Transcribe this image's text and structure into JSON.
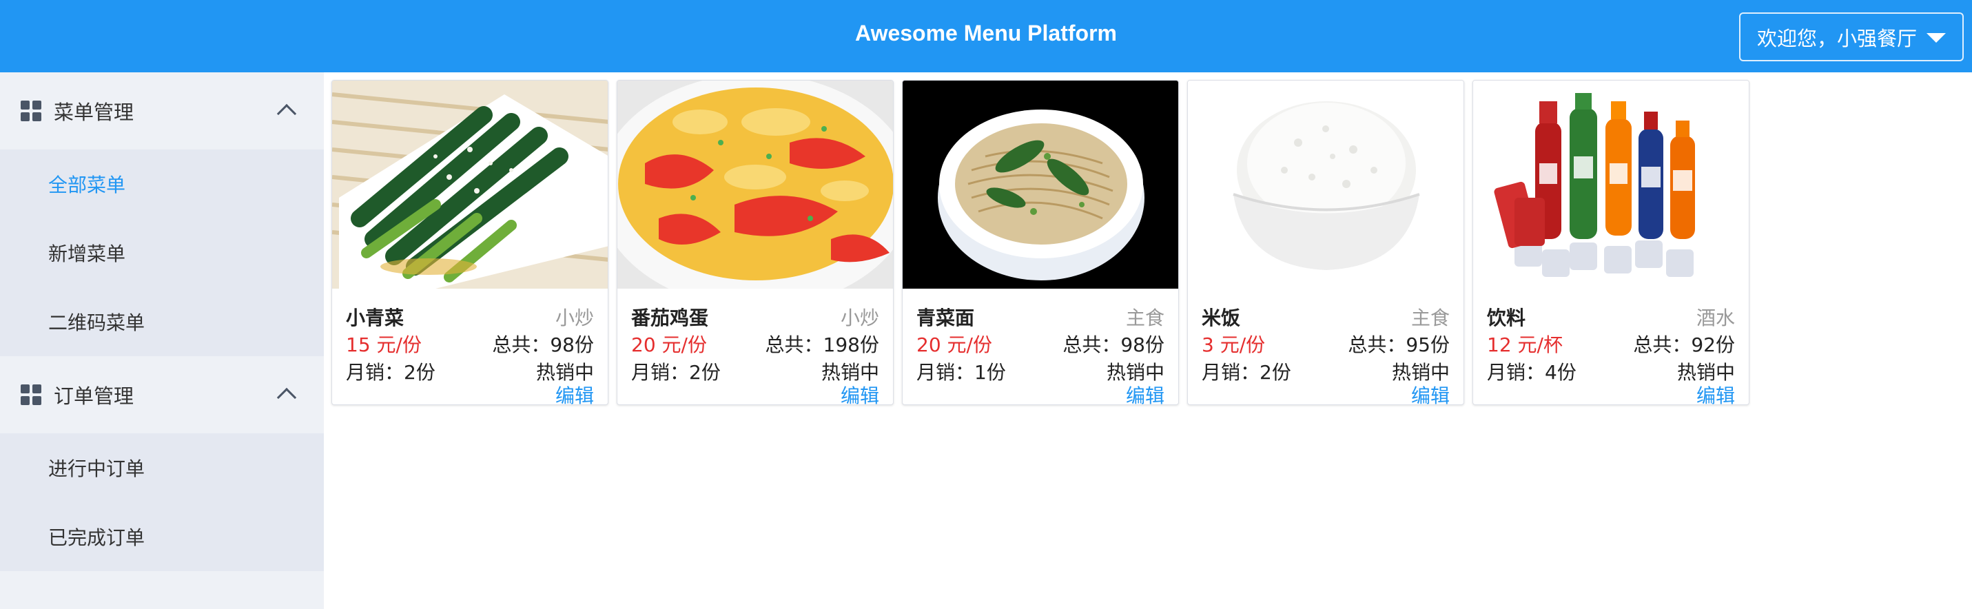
{
  "header": {
    "title": "Awesome Menu Platform",
    "user_menu_label": "欢迎您，小强餐厅"
  },
  "sidebar": {
    "groups": [
      {
        "label": "菜单管理",
        "icon": "grid-icon",
        "expanded": true,
        "items": [
          {
            "label": "全部菜单",
            "active": true
          },
          {
            "label": "新增菜单",
            "active": false
          },
          {
            "label": "二维码菜单",
            "active": false
          }
        ]
      },
      {
        "label": "订单管理",
        "icon": "grid-icon",
        "expanded": true,
        "items": [
          {
            "label": "进行中订单",
            "active": false
          },
          {
            "label": "已完成订单",
            "active": false
          }
        ]
      }
    ]
  },
  "menu_items": [
    {
      "name": "小青菜",
      "category": "小炒",
      "price": "15 元/份",
      "total": "总共：98份",
      "monthly": "月销：2份",
      "status": "热销中",
      "edit_label": "编辑",
      "image": "stir-fried-greens-photo"
    },
    {
      "name": "番茄鸡蛋",
      "category": "小炒",
      "price": "20 元/份",
      "total": "总共：198份",
      "monthly": "月销：2份",
      "status": "热销中",
      "edit_label": "编辑",
      "image": "tomato-egg-photo"
    },
    {
      "name": "青菜面",
      "category": "主食",
      "price": "20 元/份",
      "total": "总共：98份",
      "monthly": "月销：1份",
      "status": "热销中",
      "edit_label": "编辑",
      "image": "vegetable-noodles-photo"
    },
    {
      "name": "米饭",
      "category": "主食",
      "price": "3 元/份",
      "total": "总共：95份",
      "monthly": "月销：2份",
      "status": "热销中",
      "edit_label": "编辑",
      "image": "rice-bowl-photo"
    },
    {
      "name": "饮料",
      "category": "酒水",
      "price": "12 元/杯",
      "total": "总共：92份",
      "monthly": "月销：4份",
      "status": "热销中",
      "edit_label": "编辑",
      "image": "drinks-photo"
    }
  ],
  "colors": {
    "header_bg": "#2196f3",
    "sidebar_bg": "#eef1f6",
    "submenu_bg": "#e4e8f1",
    "active_link": "#2196f3",
    "price": "#e52e2e"
  }
}
